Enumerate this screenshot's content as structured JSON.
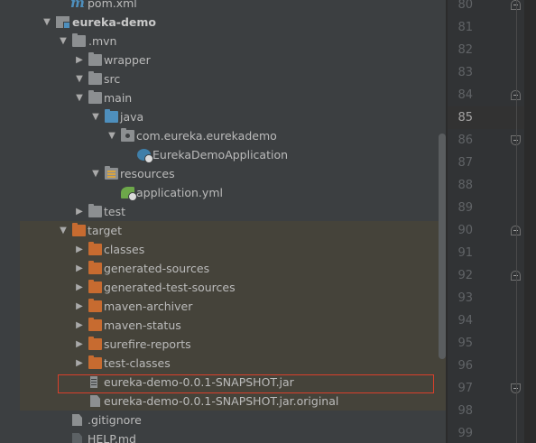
{
  "project_tree": {
    "rows": [
      {
        "label": "pom.xml",
        "icon": "maven-file-icon",
        "arrow": "",
        "target_bg": false
      },
      {
        "label": "eureka-demo",
        "icon": "module-folder-icon",
        "arrow": "expanded",
        "target_bg": false
      },
      {
        "label": ".mvn",
        "icon": "folder-icon",
        "arrow": "expanded",
        "target_bg": false
      },
      {
        "label": "wrapper",
        "icon": "folder-icon",
        "arrow": "collapsed",
        "target_bg": false
      },
      {
        "label": "src",
        "icon": "folder-icon",
        "arrow": "expanded",
        "target_bg": false
      },
      {
        "label": "main",
        "icon": "folder-icon",
        "arrow": "expanded",
        "target_bg": false
      },
      {
        "label": "java",
        "icon": "source-folder-icon",
        "arrow": "expanded",
        "target_bg": false
      },
      {
        "label": "com.eureka.eurekademo",
        "icon": "package-icon",
        "arrow": "expanded",
        "target_bg": false
      },
      {
        "label": "EurekaDemoApplication",
        "icon": "spring-boot-class-icon",
        "arrow": "",
        "target_bg": false
      },
      {
        "label": "resources",
        "icon": "resources-folder-icon",
        "arrow": "expanded",
        "target_bg": false
      },
      {
        "label": "application.yml",
        "icon": "spring-config-icon",
        "arrow": "",
        "target_bg": false
      },
      {
        "label": "test",
        "icon": "folder-icon",
        "arrow": "collapsed",
        "target_bg": false
      },
      {
        "label": "target",
        "icon": "excluded-folder-icon",
        "arrow": "expanded",
        "target_bg": true
      },
      {
        "label": "classes",
        "icon": "excluded-folder-icon",
        "arrow": "collapsed",
        "target_bg": true
      },
      {
        "label": "generated-sources",
        "icon": "excluded-folder-icon",
        "arrow": "collapsed",
        "target_bg": true
      },
      {
        "label": "generated-test-sources",
        "icon": "excluded-folder-icon",
        "arrow": "collapsed",
        "target_bg": true
      },
      {
        "label": "maven-archiver",
        "icon": "excluded-folder-icon",
        "arrow": "collapsed",
        "target_bg": true
      },
      {
        "label": "maven-status",
        "icon": "excluded-folder-icon",
        "arrow": "collapsed",
        "target_bg": true
      },
      {
        "label": "surefire-reports",
        "icon": "excluded-folder-icon",
        "arrow": "collapsed",
        "target_bg": true
      },
      {
        "label": "test-classes",
        "icon": "excluded-folder-icon",
        "arrow": "collapsed",
        "target_bg": true
      },
      {
        "label": "eureka-demo-0.0.1-SNAPSHOT.jar",
        "icon": "jar-file-icon",
        "arrow": "",
        "target_bg": true,
        "highlighted": true
      },
      {
        "label": "eureka-demo-0.0.1-SNAPSHOT.jar.original",
        "icon": "file-icon",
        "arrow": "",
        "target_bg": true
      },
      {
        "label": ".gitignore",
        "icon": "file-icon",
        "arrow": "",
        "target_bg": false
      },
      {
        "label": "HELP.md",
        "icon": "markdown-file-icon",
        "arrow": "",
        "target_bg": false
      }
    ]
  },
  "editor_gutter": {
    "current_line": "85",
    "lines": [
      {
        "num": "80",
        "fold": "up"
      },
      {
        "num": "81",
        "fold": ""
      },
      {
        "num": "82",
        "fold": ""
      },
      {
        "num": "83",
        "fold": ""
      },
      {
        "num": "84",
        "fold": "up"
      },
      {
        "num": "85",
        "fold": ""
      },
      {
        "num": "86",
        "fold": "down"
      },
      {
        "num": "87",
        "fold": ""
      },
      {
        "num": "88",
        "fold": ""
      },
      {
        "num": "89",
        "fold": ""
      },
      {
        "num": "90",
        "fold": "up"
      },
      {
        "num": "91",
        "fold": ""
      },
      {
        "num": "92",
        "fold": "up"
      },
      {
        "num": "93",
        "fold": ""
      },
      {
        "num": "94",
        "fold": ""
      },
      {
        "num": "95",
        "fold": ""
      },
      {
        "num": "96",
        "fold": ""
      },
      {
        "num": "97",
        "fold": "down"
      },
      {
        "num": "98",
        "fold": ""
      },
      {
        "num": "99",
        "fold": ""
      }
    ]
  },
  "colors": {
    "panel_bg": "#3c3f41",
    "target_bg": "#45433a",
    "excluded_folder": "#c76b30",
    "source_folder": "#4e8fbd",
    "selection_border": "#d9402b",
    "gutter_bg": "#313335"
  }
}
